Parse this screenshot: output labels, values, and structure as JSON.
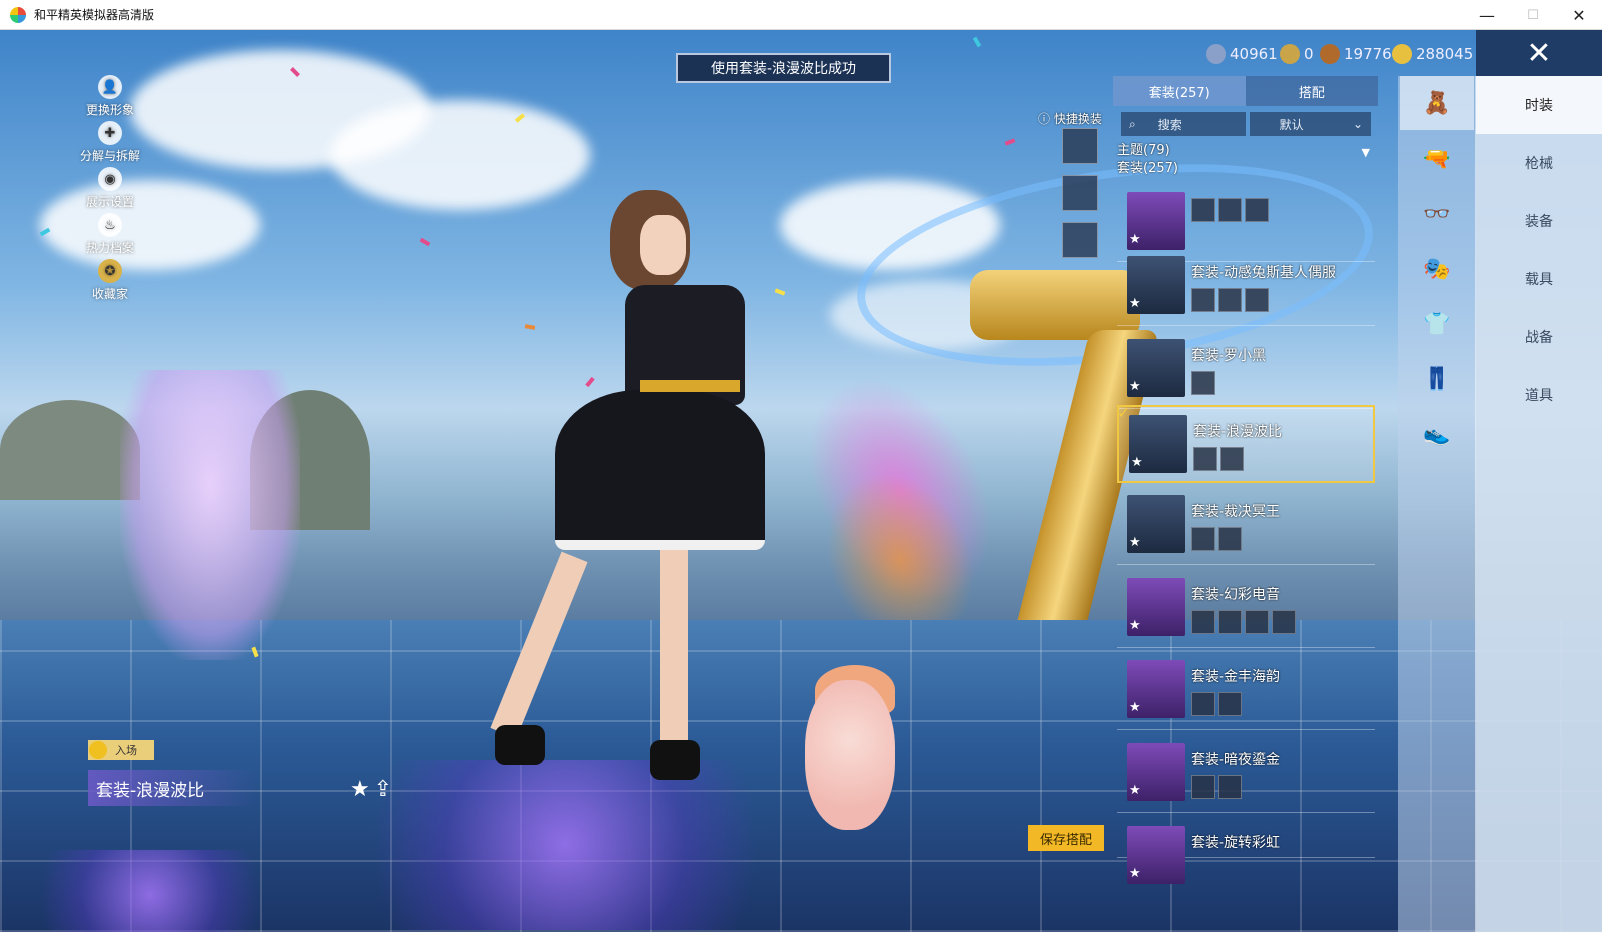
{
  "window": {
    "title": "和平精英模拟器高清版",
    "min_label": "—",
    "max_label": "☐",
    "close_label": "✕"
  },
  "toast": "使用套装-浪漫波比成功",
  "currency": [
    {
      "icon": "crystal-coin-icon",
      "value": "40961",
      "color": "#8aa0c8"
    },
    {
      "icon": "medal-coin-icon",
      "value": "0",
      "color": "#c9a448"
    },
    {
      "icon": "bronze-coin-icon",
      "value": "19776",
      "color": "#b06a2c"
    },
    {
      "icon": "gold-coin-icon",
      "value": "288045",
      "color": "#e8c040"
    }
  ],
  "close_button": "✕",
  "left_menu": [
    {
      "label": "更换形象",
      "icon": "person-icon",
      "glyph": "👤"
    },
    {
      "label": "分解与拆解",
      "icon": "puzzle-icon",
      "glyph": "✚"
    },
    {
      "label": "展示设置",
      "icon": "eye-icon",
      "glyph": "◉"
    },
    {
      "label": "热力档案",
      "icon": "flame-icon",
      "glyph": "♨"
    },
    {
      "label": "收藏家",
      "icon": "collector-badge-icon",
      "glyph": "✪"
    }
  ],
  "panel": {
    "tabs": [
      "套装(257)",
      "搭配"
    ],
    "active_tab": 0,
    "search_placeholder": "搜索",
    "sort_label": "默认",
    "filter_theme": "主题(79)",
    "filter_suit": "套装(257)",
    "outfits": [
      {
        "name": "",
        "parts": 3,
        "purple": true
      },
      {
        "name": "套装-动感兔斯基人偶服",
        "parts": 3,
        "purple": false
      },
      {
        "name": "套装-罗小黑",
        "parts": 1,
        "purple": false
      },
      {
        "name": "套装-浪漫波比",
        "parts": 2,
        "purple": false,
        "selected": true
      },
      {
        "name": "套装-裁决冥王",
        "parts": 2,
        "purple": false
      },
      {
        "name": "套装-幻彩电音",
        "parts": 4,
        "purple": true
      },
      {
        "name": "套装-金丰海韵",
        "parts": 2,
        "purple": true
      },
      {
        "name": "套装-暗夜鎏金",
        "parts": 2,
        "purple": true
      },
      {
        "name": "套装-旋转彩虹",
        "parts": 0,
        "purple": true
      }
    ]
  },
  "quick_switch_label": "快捷换装",
  "icon_tabs": [
    {
      "icon": "outfit-icon",
      "glyph": "🧸"
    },
    {
      "icon": "weapon-skin-icon",
      "glyph": "🔫"
    },
    {
      "icon": "glasses-icon",
      "glyph": "👓"
    },
    {
      "icon": "mask-icon",
      "glyph": "🎭"
    },
    {
      "icon": "top-icon",
      "glyph": "👕"
    },
    {
      "icon": "pants-icon",
      "glyph": "👖"
    },
    {
      "icon": "shoes-icon",
      "glyph": "👟"
    }
  ],
  "categories": [
    "时装",
    "枪械",
    "装备",
    "载具",
    "战备",
    "道具"
  ],
  "active_category": 0,
  "save_button": "保存搭配",
  "entry_tag": "入场",
  "current_outfit": "套装-浪漫波比",
  "fav_glyph": "★",
  "share_glyph": "⇪"
}
